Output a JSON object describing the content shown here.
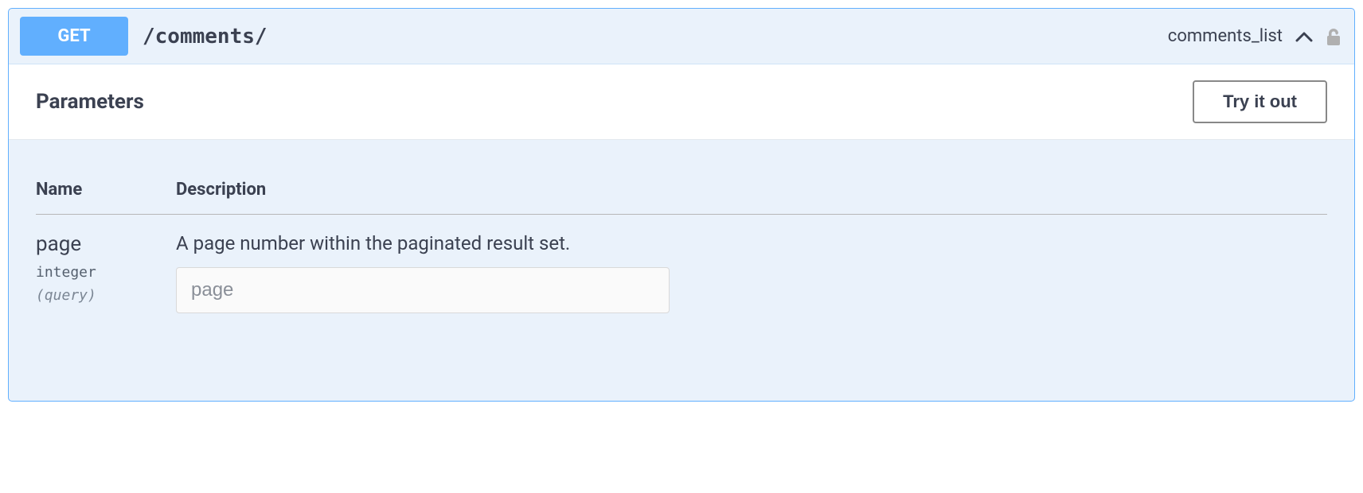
{
  "operation": {
    "method": "GET",
    "path": "/comments/",
    "operation_id": "comments_list"
  },
  "sections": {
    "parameters_title": "Parameters",
    "try_it_out_label": "Try it out"
  },
  "table": {
    "col_name": "Name",
    "col_description": "Description"
  },
  "parameters": [
    {
      "name": "page",
      "type": "integer",
      "in": "(query)",
      "description": "A page number within the paginated result set.",
      "placeholder": "page"
    }
  ]
}
